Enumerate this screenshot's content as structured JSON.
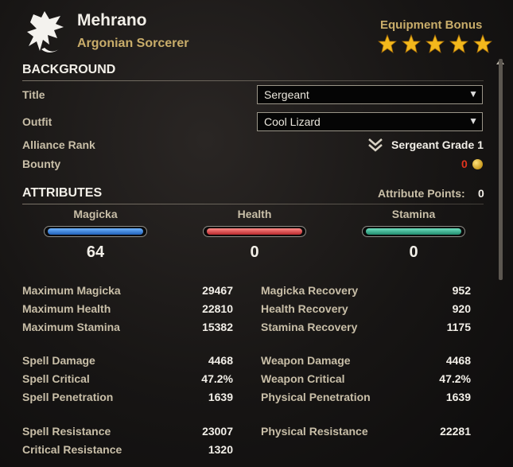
{
  "header": {
    "name": "Mehrano",
    "race_class": "Argonian Sorcerer",
    "equipment_bonus_label": "Equipment Bonus",
    "equipment_bonus_stars": 5,
    "emblem_icon": "dragon-emblem-icon"
  },
  "background": {
    "title": "BACKGROUND",
    "title_label": "Title",
    "title_value": "Sergeant",
    "outfit_label": "Outfit",
    "outfit_value": "Cool Lizard",
    "alliance_rank_label": "Alliance Rank",
    "alliance_rank_value": "Sergeant Grade 1",
    "bounty_label": "Bounty",
    "bounty_value": "0"
  },
  "attributes": {
    "title": "ATTRIBUTES",
    "points_label": "Attribute Points:",
    "points_value": "0",
    "items": [
      {
        "name": "Magicka",
        "value": "64",
        "color": "#2f7fd8"
      },
      {
        "name": "Health",
        "value": "0",
        "color": "#d8363a"
      },
      {
        "name": "Stamina",
        "value": "0",
        "color": "#2ea386"
      }
    ]
  },
  "stats": {
    "group1": [
      {
        "l_label": "Maximum Magicka",
        "l_value": "29467",
        "r_label": "Magicka Recovery",
        "r_value": "952"
      },
      {
        "l_label": "Maximum Health",
        "l_value": "22810",
        "r_label": "Health Recovery",
        "r_value": "920"
      },
      {
        "l_label": "Maximum Stamina",
        "l_value": "15382",
        "r_label": "Stamina Recovery",
        "r_value": "1175"
      }
    ],
    "group2": [
      {
        "l_label": "Spell Damage",
        "l_value": "4468",
        "r_label": "Weapon Damage",
        "r_value": "4468"
      },
      {
        "l_label": "Spell Critical",
        "l_value": "47.2%",
        "r_label": "Weapon Critical",
        "r_value": "47.2%"
      },
      {
        "l_label": "Spell Penetration",
        "l_value": "1639",
        "r_label": "Physical Penetration",
        "r_value": "1639"
      }
    ],
    "group3": [
      {
        "l_label": "Spell Resistance",
        "l_value": "23007",
        "r_label": "Physical Resistance",
        "r_value": "22281"
      },
      {
        "l_label": "Critical Resistance",
        "l_value": "1320",
        "r_label": "",
        "r_value": ""
      }
    ]
  }
}
